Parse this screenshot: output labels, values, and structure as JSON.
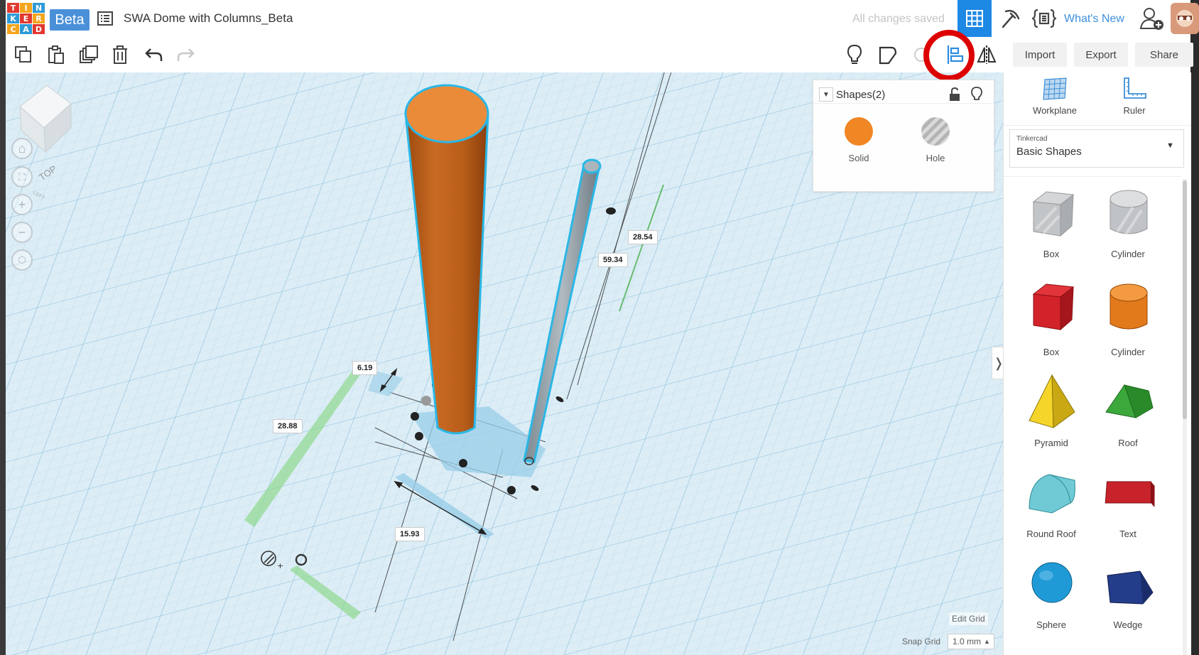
{
  "app": {
    "logo_letters": [
      "T",
      "I",
      "N",
      "K",
      "E",
      "R",
      "C",
      "A",
      "D"
    ],
    "beta": "Beta",
    "project_title": "SWA Dome with Columns_Beta",
    "save_status": "All changes saved",
    "whats_new": "What's New"
  },
  "toolbar": {
    "import": "Import",
    "export": "Export",
    "share": "Share"
  },
  "shapes_panel": {
    "title": "Shapes(2)",
    "solid": "Solid",
    "hole": "Hole"
  },
  "view_cube": {
    "top": "TOP",
    "left": "LEFT"
  },
  "dimensions": {
    "width": "6.19",
    "length": "28.88",
    "depth": "15.93",
    "height": "59.34",
    "elevation": "28.54"
  },
  "right_panel": {
    "workplane": "Workplane",
    "ruler": "Ruler",
    "library_source": "Tinkercad",
    "library_name": "Basic Shapes",
    "shapes": [
      {
        "label": "Box"
      },
      {
        "label": "Cylinder"
      },
      {
        "label": "Box"
      },
      {
        "label": "Cylinder"
      },
      {
        "label": "Pyramid"
      },
      {
        "label": "Roof"
      },
      {
        "label": "Round Roof"
      },
      {
        "label": "Text"
      },
      {
        "label": "Sphere"
      },
      {
        "label": "Wedge"
      }
    ]
  },
  "grid": {
    "edit_grid": "Edit Grid",
    "snap_label": "Snap Grid",
    "snap_value": "1.0 mm"
  },
  "colors": {
    "accent": "#1e88e5",
    "solid": "#f08624",
    "selection": "#2ab7e6",
    "annotation": "#d00000"
  }
}
